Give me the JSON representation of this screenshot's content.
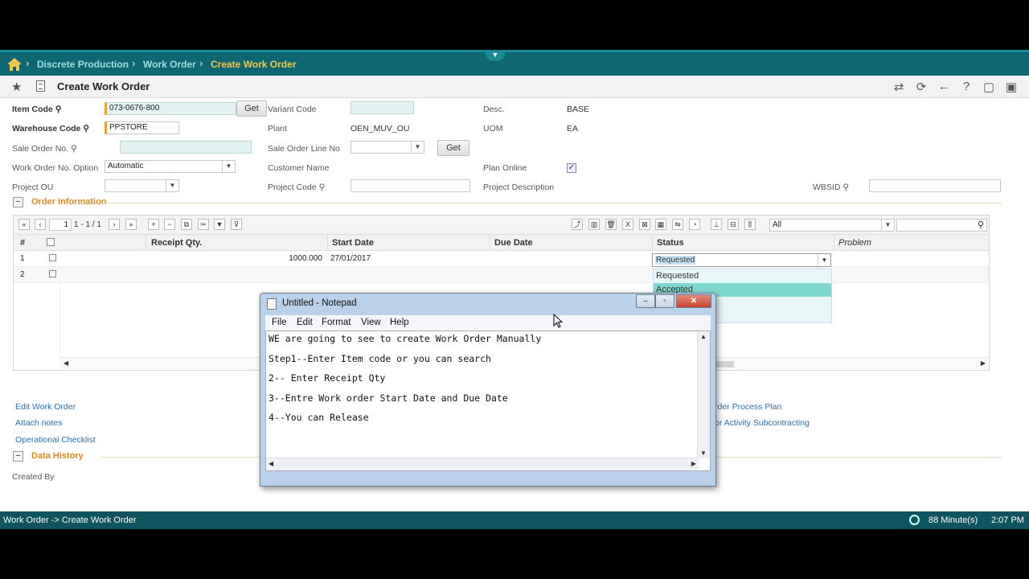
{
  "breadcrumb": {
    "items": [
      "Discrete Production",
      "Work Order",
      "Create Work Order"
    ]
  },
  "page_title": "Create Work Order",
  "form": {
    "item_code_label": "Item Code",
    "item_code_value": "073-0676-800",
    "get_label": "Get",
    "variant_code_label": "Variant Code",
    "desc_label": "Desc.",
    "desc_value": "BASE",
    "warehouse_code_label": "Warehouse Code",
    "warehouse_code_value": "PPSTORE",
    "plant_label": "Plant",
    "plant_value": "OEN_MUV_OU",
    "uom_label": "UOM",
    "uom_value": "EA",
    "sale_order_no_label": "Sale Order No.",
    "sale_order_line_no_label": "Sale Order Line No",
    "work_order_no_option_label": "Work Order No. Option",
    "work_order_no_option_value": "Automatic",
    "customer_name_label": "Customer Name",
    "plan_online_label": "Plan Online",
    "project_ou_label": "Project OU",
    "project_code_label": "Project Code",
    "project_description_label": "Project Description",
    "wbsid_label": "WBSID"
  },
  "order_info": {
    "title": "Order Information",
    "pager": "1 - 1 / 1",
    "page_input": "1",
    "filter_value": "All",
    "columns": [
      "#",
      "Receipt Qty.",
      "Start Date",
      "Due Date",
      "Status",
      "Problem"
    ],
    "rows": [
      {
        "num": "1",
        "receipt_qty": "1000.000",
        "start_date": "27/01/2017",
        "due_date": "",
        "status": "Requested"
      },
      {
        "num": "2",
        "receipt_qty": "",
        "start_date": "",
        "due_date": "",
        "status": ""
      }
    ],
    "status_options": [
      "Requested",
      "Accepted"
    ]
  },
  "links": {
    "edit_work_order": "Edit Work Order",
    "attach_notes": "Attach notes",
    "operational_checklist": "Operational Checklist",
    "order_process_plan": "rder Process Plan",
    "activity_subcontracting": "or Activity Subcontracting"
  },
  "data_history": {
    "title": "Data History",
    "created_by_label": "Created By"
  },
  "statusbar": {
    "path": "Work Order -> Create Work Order",
    "session": "88 Minute(s)",
    "time": "2:07 PM"
  },
  "notepad": {
    "title": "Untitled - Notepad",
    "menu": [
      "File",
      "Edit",
      "Format",
      "View",
      "Help"
    ],
    "lines": [
      "WE are going to see to create Work Order Manually",
      "Step1--Enter Item code or you can search",
      "2-- Enter Receipt Qty",
      "3--Entre Work order Start Date and Due Date",
      "4--You can Release"
    ]
  },
  "colors": {
    "header_bg": "#106774",
    "section_title": "#e08a1e",
    "link": "#2a6fb5",
    "accent_highlight": "#7fd8cf"
  }
}
